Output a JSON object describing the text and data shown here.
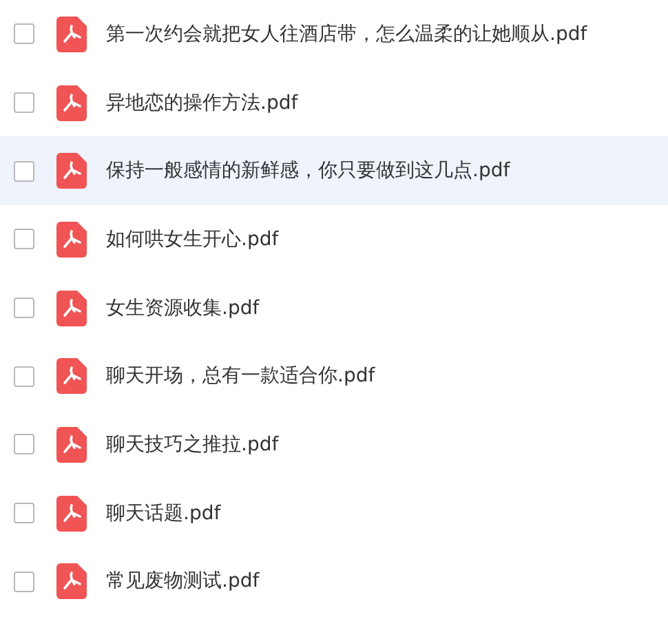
{
  "files": [
    {
      "name": "第一次约会就把女人往酒店带，怎么温柔的让她顺从.pdf",
      "checked": false,
      "highlighted": false
    },
    {
      "name": "异地恋的操作方法.pdf",
      "checked": false,
      "highlighted": false
    },
    {
      "name": "保持一般感情的新鲜感，你只要做到这几点.pdf",
      "checked": false,
      "highlighted": true
    },
    {
      "name": "如何哄女生开心.pdf",
      "checked": false,
      "highlighted": false
    },
    {
      "name": "女生资源收集.pdf",
      "checked": false,
      "highlighted": false
    },
    {
      "name": "聊天开场，总有一款适合你.pdf",
      "checked": false,
      "highlighted": false
    },
    {
      "name": "聊天技巧之推拉.pdf",
      "checked": false,
      "highlighted": false
    },
    {
      "name": "聊天话题.pdf",
      "checked": false,
      "highlighted": false
    },
    {
      "name": "常见废物测试.pdf",
      "checked": false,
      "highlighted": false
    }
  ]
}
